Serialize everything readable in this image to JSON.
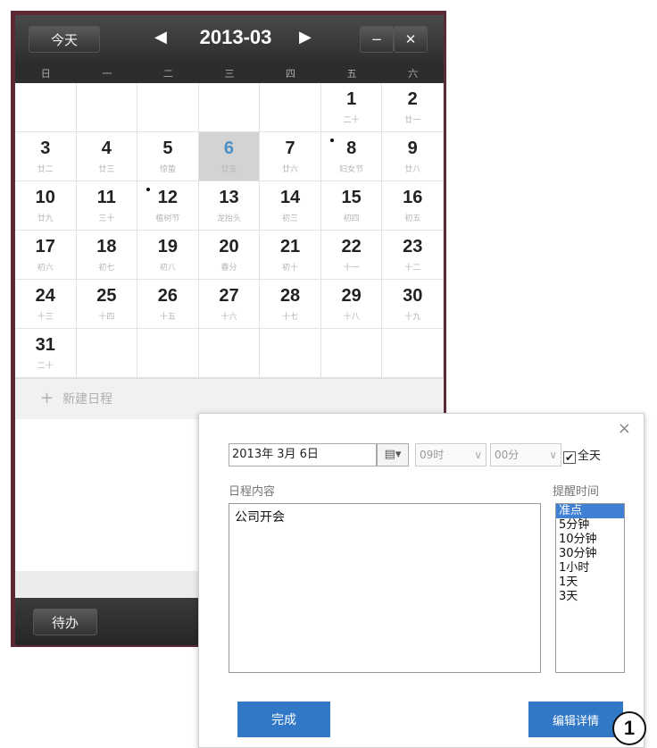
{
  "calendar": {
    "today_label": "今天",
    "month_title": "2013-03",
    "prev_symbol": "◀",
    "next_symbol": "▶",
    "minimize_symbol": "−",
    "close_symbol": "✕",
    "weekdays": [
      "日",
      "一",
      "二",
      "三",
      "四",
      "五",
      "六"
    ],
    "days": [
      {
        "num": "",
        "lunar": ""
      },
      {
        "num": "",
        "lunar": ""
      },
      {
        "num": "",
        "lunar": ""
      },
      {
        "num": "",
        "lunar": ""
      },
      {
        "num": "",
        "lunar": ""
      },
      {
        "num": "1",
        "lunar": "二十"
      },
      {
        "num": "2",
        "lunar": "廿一"
      },
      {
        "num": "3",
        "lunar": "廿二"
      },
      {
        "num": "4",
        "lunar": "廿三"
      },
      {
        "num": "5",
        "lunar": "惊蛰"
      },
      {
        "num": "6",
        "lunar": "廿五",
        "today": true
      },
      {
        "num": "7",
        "lunar": "廿六"
      },
      {
        "num": "8",
        "lunar": "妇女节",
        "dot": true
      },
      {
        "num": "9",
        "lunar": "廿八"
      },
      {
        "num": "10",
        "lunar": "廿九"
      },
      {
        "num": "11",
        "lunar": "三十"
      },
      {
        "num": "12",
        "lunar": "植树节",
        "dot": true
      },
      {
        "num": "13",
        "lunar": "龙抬头"
      },
      {
        "num": "14",
        "lunar": "初三"
      },
      {
        "num": "15",
        "lunar": "初四"
      },
      {
        "num": "16",
        "lunar": "初五"
      },
      {
        "num": "17",
        "lunar": "初六"
      },
      {
        "num": "18",
        "lunar": "初七"
      },
      {
        "num": "19",
        "lunar": "初八"
      },
      {
        "num": "20",
        "lunar": "春分"
      },
      {
        "num": "21",
        "lunar": "初十"
      },
      {
        "num": "22",
        "lunar": "十一"
      },
      {
        "num": "23",
        "lunar": "十二"
      },
      {
        "num": "24",
        "lunar": "十三"
      },
      {
        "num": "25",
        "lunar": "十四"
      },
      {
        "num": "26",
        "lunar": "十五"
      },
      {
        "num": "27",
        "lunar": "十六"
      },
      {
        "num": "28",
        "lunar": "十七"
      },
      {
        "num": "29",
        "lunar": "十八"
      },
      {
        "num": "30",
        "lunar": "十九"
      },
      {
        "num": "31",
        "lunar": "二十"
      },
      {
        "num": "",
        "lunar": ""
      },
      {
        "num": "",
        "lunar": ""
      },
      {
        "num": "",
        "lunar": ""
      },
      {
        "num": "",
        "lunar": ""
      },
      {
        "num": "",
        "lunar": ""
      },
      {
        "num": "",
        "lunar": ""
      }
    ],
    "new_schedule_icon": "+",
    "new_schedule_label": "新建日程",
    "todo_label": "待办"
  },
  "dialog": {
    "close_symbol": "×",
    "date_value": "2013年  3月  6日",
    "date_button": "▤▾",
    "hour_value": "09时",
    "minute_value": "00分",
    "select_caret": "∨",
    "allday_check": "✔",
    "allday_label": "全天",
    "content_label": "日程内容",
    "content_value": "公司开会",
    "remind_label": "提醒时间",
    "remind_options": [
      "准点",
      "5分钟",
      "10分钟",
      "30分钟",
      "1小时",
      "1天",
      "3天"
    ],
    "remind_selected_index": 0,
    "done_label": "完成",
    "edit_label": "编辑详情"
  },
  "callout_number": "1",
  "colors": {
    "frame": "#5b2a35",
    "header": "#2c2c2c",
    "today_cell": "#d3d3d3",
    "accent_blue": "#3178c6"
  }
}
